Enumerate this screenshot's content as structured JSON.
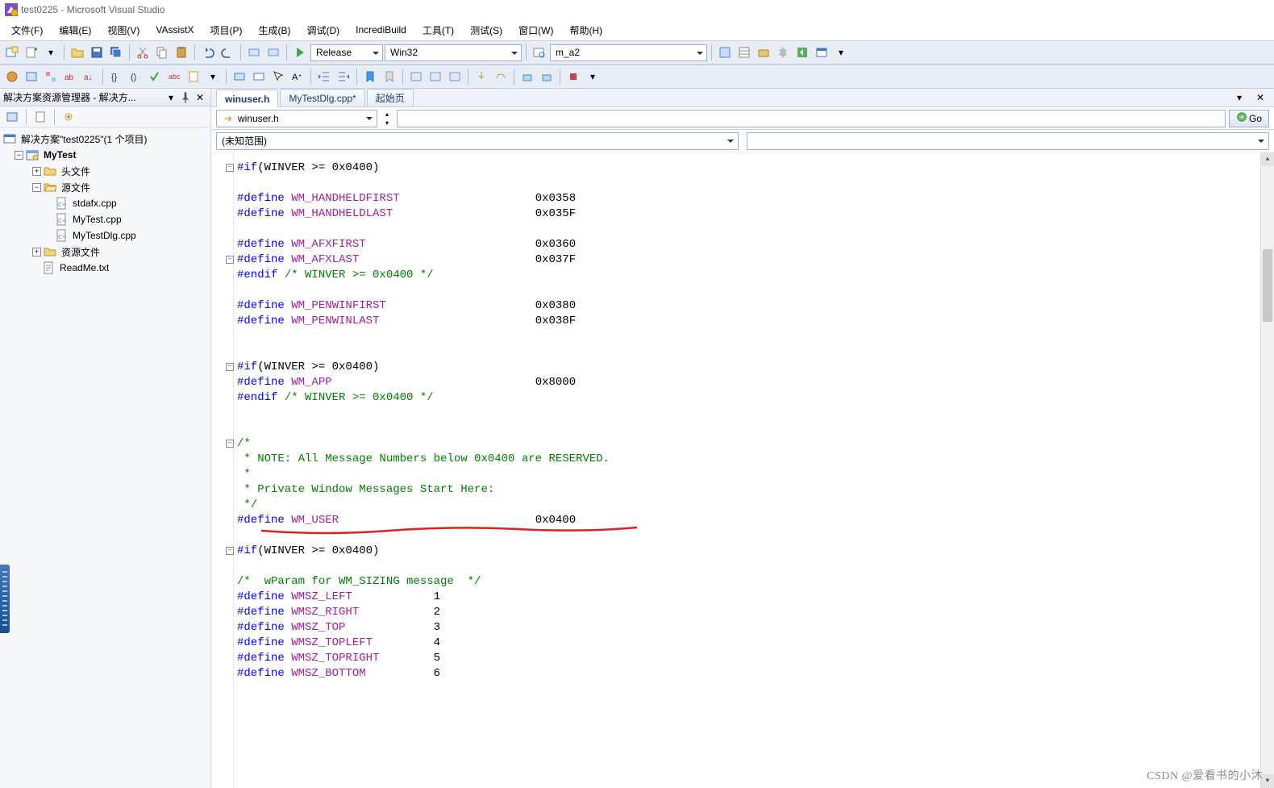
{
  "window": {
    "title": "test0225 - Microsoft Visual Studio"
  },
  "menu": [
    "文件(F)",
    "编辑(E)",
    "视图(V)",
    "VAssistX",
    "项目(P)",
    "生成(B)",
    "调试(D)",
    "IncrediBuild",
    "工具(T)",
    "测试(S)",
    "窗口(W)",
    "帮助(H)"
  ],
  "toolbar1": {
    "config": "Release",
    "platform": "Win32",
    "search": "m_a2"
  },
  "solution_panel": {
    "title": "解决方案资源管理器 - 解决方...",
    "root": "解决方案\"test0225\"(1 个项目)",
    "project": "MyTest",
    "folders": {
      "headers": "头文件",
      "sources": "源文件",
      "resources": "资源文件"
    },
    "source_files": [
      "stdafx.cpp",
      "MyTest.cpp",
      "MyTestDlg.cpp"
    ],
    "readme": "ReadMe.txt"
  },
  "tabs": {
    "items": [
      "winuser.h",
      "MyTestDlg.cpp*",
      "起始页"
    ],
    "active": 0
  },
  "nav": {
    "file": "winuser.h",
    "go": "Go",
    "scope": "(未知范围)"
  },
  "code": {
    "lines": [
      {
        "t": "if",
        "text": "#if(WINVER >= 0x0400)",
        "fold": true
      },
      {
        "t": "blank"
      },
      {
        "t": "def",
        "name": "WM_HANDHELDFIRST",
        "val": "0x0358"
      },
      {
        "t": "def",
        "name": "WM_HANDHELDLAST",
        "val": "0x035F"
      },
      {
        "t": "blank"
      },
      {
        "t": "def",
        "name": "WM_AFXFIRST",
        "val": "0x0360"
      },
      {
        "t": "def",
        "name": "WM_AFXLAST",
        "val": "0x037F",
        "fold": true
      },
      {
        "t": "endif",
        "text": "#endif /* WINVER >= 0x0400 */"
      },
      {
        "t": "blank"
      },
      {
        "t": "def",
        "name": "WM_PENWINFIRST",
        "val": "0x0380"
      },
      {
        "t": "def",
        "name": "WM_PENWINLAST",
        "val": "0x038F"
      },
      {
        "t": "blank"
      },
      {
        "t": "blank"
      },
      {
        "t": "if",
        "text": "#if(WINVER >= 0x0400)",
        "fold": true
      },
      {
        "t": "def",
        "name": "WM_APP",
        "val": "0x8000"
      },
      {
        "t": "endif",
        "text": "#endif /* WINVER >= 0x0400 */"
      },
      {
        "t": "blank"
      },
      {
        "t": "blank"
      },
      {
        "t": "cmt",
        "text": "/*",
        "fold": true
      },
      {
        "t": "cmt",
        "text": " * NOTE: All Message Numbers below 0x0400 are RESERVED."
      },
      {
        "t": "cmt",
        "text": " *"
      },
      {
        "t": "cmt",
        "text": " * Private Window Messages Start Here:"
      },
      {
        "t": "cmt",
        "text": " */"
      },
      {
        "t": "def",
        "name": "WM_USER",
        "val": "0x0400",
        "mark": true
      },
      {
        "t": "blank"
      },
      {
        "t": "if",
        "text": "#if(WINVER >= 0x0400)",
        "fold": true
      },
      {
        "t": "blank"
      },
      {
        "t": "cmt",
        "text": "/*  wParam for WM_SIZING message  */"
      },
      {
        "t": "def2",
        "name": "WMSZ_LEFT",
        "val": "1"
      },
      {
        "t": "def2",
        "name": "WMSZ_RIGHT",
        "val": "2"
      },
      {
        "t": "def2",
        "name": "WMSZ_TOP",
        "val": "3"
      },
      {
        "t": "def2",
        "name": "WMSZ_TOPLEFT",
        "val": "4"
      },
      {
        "t": "def2",
        "name": "WMSZ_TOPRIGHT",
        "val": "5"
      },
      {
        "t": "def2",
        "name": "WMSZ_BOTTOM",
        "val": "6"
      }
    ]
  },
  "watermark": "CSDN @爱看书的小沐"
}
